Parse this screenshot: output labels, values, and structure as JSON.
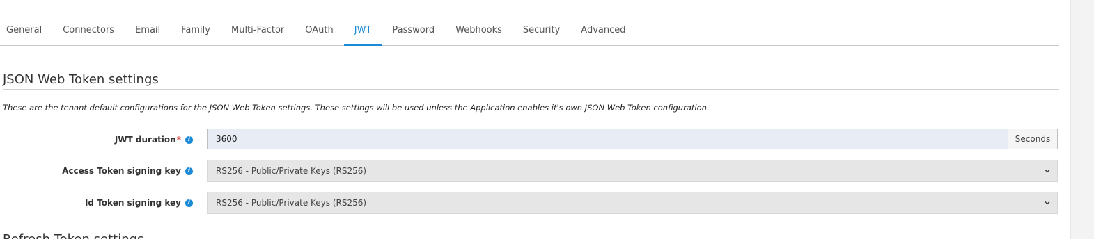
{
  "tabs": [
    {
      "label": "General"
    },
    {
      "label": "Connectors"
    },
    {
      "label": "Email"
    },
    {
      "label": "Family"
    },
    {
      "label": "Multi-Factor"
    },
    {
      "label": "OAuth"
    },
    {
      "label": "JWT",
      "active": true
    },
    {
      "label": "Password"
    },
    {
      "label": "Webhooks"
    },
    {
      "label": "Security"
    },
    {
      "label": "Advanced"
    }
  ],
  "section": {
    "title": "JSON Web Token settings",
    "description": "These are the tenant default configurations for the JSON Web Token settings. These settings will be used unless the Application enables it's own JSON Web Token configuration."
  },
  "fields": {
    "jwt_duration": {
      "label": "JWT duration",
      "required_mark": "*",
      "value": "3600",
      "addon": "Seconds"
    },
    "access_token_key": {
      "label": "Access Token signing key",
      "selected": "RS256 - Public/Private Keys (RS256)"
    },
    "id_token_key": {
      "label": "Id Token signing key",
      "selected": "RS256 - Public/Private Keys (RS256)"
    }
  },
  "next_section": {
    "title": "Refresh Token settings"
  },
  "colors": {
    "accent": "#1a8ad6",
    "required": "#d9534f",
    "input_bg": "#e8edf5",
    "select_bg": "#e6e6e6"
  },
  "icons": [
    "info-icon",
    "chevron-down-icon"
  ]
}
